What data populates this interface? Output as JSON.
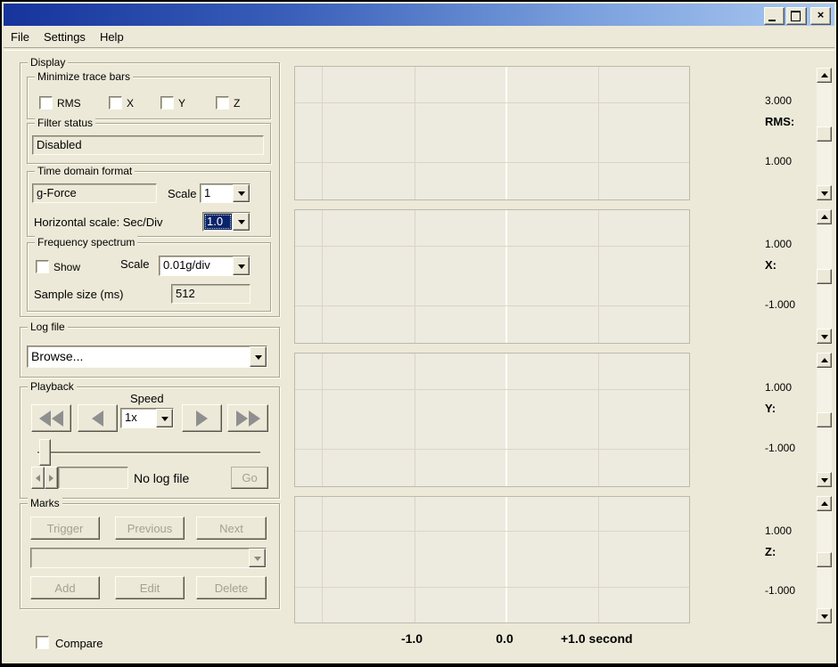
{
  "window": {
    "controls": {
      "minimize": "minimize",
      "maximize": "maximize",
      "close_glyph": "×"
    }
  },
  "menu": {
    "items": [
      "File",
      "Settings",
      "Help"
    ]
  },
  "display": {
    "legend": "Display",
    "minimize_trace_bars": {
      "legend": "Minimize trace bars",
      "checkboxes": [
        {
          "label": "RMS",
          "checked": false
        },
        {
          "label": "X",
          "checked": false
        },
        {
          "label": "Y",
          "checked": false
        },
        {
          "label": "Z",
          "checked": false
        }
      ]
    },
    "filter_status": {
      "legend": "Filter status",
      "value": "Disabled"
    },
    "time_domain": {
      "legend": "Time domain format",
      "format_value": "g-Force",
      "scale_label": "Scale",
      "scale_value": "1",
      "hscale_label": "Horizontal scale: Sec/Div",
      "hscale_value": "1.0"
    },
    "frequency_spectrum": {
      "legend": "Frequency spectrum",
      "show_label": "Show",
      "show_checked": false,
      "scale_label": "Scale",
      "scale_value": "0.01g/div",
      "sample_label": "Sample size (ms)",
      "sample_value": "512"
    }
  },
  "log_file": {
    "legend": "Log file",
    "value": "Browse..."
  },
  "playback": {
    "legend": "Playback",
    "speed_label": "Speed",
    "speed_value": "1x",
    "status_text": "No log file",
    "go_label": "Go",
    "position_value": ""
  },
  "marks": {
    "legend": "Marks",
    "trigger_label": "Trigger",
    "previous_label": "Previous",
    "next_label": "Next",
    "add_label": "Add",
    "edit_label": "Edit",
    "delete_label": "Delete",
    "selected_mark": ""
  },
  "compare": {
    "label": "Compare",
    "checked": false
  },
  "charts": [
    {
      "id": "rms",
      "axis_label": "RMS:",
      "top_value": "3.000",
      "bottom_value": "1.000"
    },
    {
      "id": "x",
      "axis_label": "X:",
      "top_value": "1.000",
      "bottom_value": "-1.000"
    },
    {
      "id": "y",
      "axis_label": "Y:",
      "top_value": "1.000",
      "bottom_value": "-1.000"
    },
    {
      "id": "z",
      "axis_label": "Z:",
      "top_value": "1.000",
      "bottom_value": "-1.000"
    }
  ],
  "time_axis": {
    "neg": "-1.0",
    "zero": "0.0",
    "pos": "+1.0 second"
  },
  "colors": {
    "window_bg": "#ece9d8",
    "titlebar_start": "#16349c",
    "titlebar_end": "#abc9f1",
    "selection": "#0a246a",
    "chart_bg": "#edeadf",
    "gridline": "#d9d5c7",
    "center_line": "#ffffff",
    "disabled_text": "#a5a190"
  }
}
